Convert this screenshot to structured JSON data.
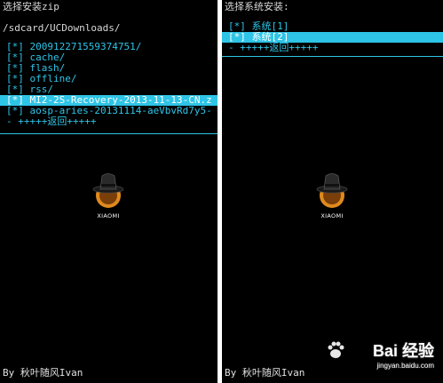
{
  "left": {
    "title": "选择安装zip",
    "path": "/sdcard/UCDownloads/",
    "items": [
      "[*] 200912271559374751/",
      "[*] cache/",
      "[*] flash/",
      "[*] offline/",
      "[*] rss/",
      "[*] MI2-2S-Recovery-2013-11-13-CN.z",
      "[*] aosp-aries-20131114-aeVbvRd7y5-",
      "- +++++返回+++++"
    ],
    "selected_index": 5,
    "logo_label": "XIAOMI",
    "footer": "By 秋叶随风Ivan"
  },
  "right": {
    "title": "选择系统安装:",
    "items": [
      "[*] 系统[1]",
      "[*] 系统[2]",
      "- +++++返回+++++"
    ],
    "selected_index": 1,
    "logo_label": "XIAOMI",
    "footer": "By 秋叶随风Ivan"
  },
  "watermark": {
    "brand": "Bai 经验",
    "url": "jingyan.baidu.com"
  },
  "colors": {
    "accent": "#2ec4e6",
    "background": "#000000",
    "text": "#d8d8d8"
  }
}
